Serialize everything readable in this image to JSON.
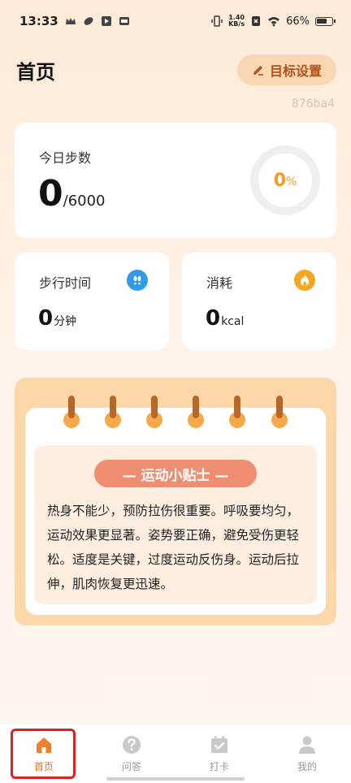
{
  "status_bar": {
    "time": "13:33",
    "net_speed_value": "1.40",
    "net_speed_unit": "KB/s",
    "battery": "66%"
  },
  "header": {
    "title": "首页",
    "goal_button": "目标设置"
  },
  "device_id": "876ba4",
  "steps_card": {
    "label": "今日步数",
    "value": "0",
    "goal": "/6000",
    "progress_percent": 0,
    "progress_num": "0",
    "progress_symbol": "%"
  },
  "walk_card": {
    "label": "步行时间",
    "value": "0",
    "unit": "分钟",
    "icon": "footprints-icon"
  },
  "burn_card": {
    "label": "消耗",
    "value": "0",
    "unit": "kcal",
    "icon": "flame-icon"
  },
  "tips": {
    "title": "— 运动小贴士 —",
    "text": "热身不能少，预防拉伤很重要。呼吸要均匀，运动效果更显著。姿势要正确，避免受伤更轻松。适度是关键，过度运动反伤身。运动后拉伸，肌肉恢复更迅速。"
  },
  "tabs": [
    {
      "label": "首页",
      "icon": "home-icon",
      "active": true
    },
    {
      "label": "问答",
      "icon": "question-icon",
      "active": false
    },
    {
      "label": "打卡",
      "icon": "checkin-calendar-icon",
      "active": false
    },
    {
      "label": "我的",
      "icon": "profile-icon",
      "active": false
    }
  ],
  "colors": {
    "accent": "#f59a23",
    "tab_active": "#ea6a1f",
    "tips_title_bg": "#f08e72",
    "highlight": "#e0201e"
  }
}
